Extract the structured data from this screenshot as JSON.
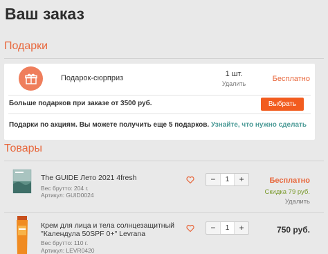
{
  "page": {
    "title": "Ваш заказ"
  },
  "gifts": {
    "heading": "Подарки",
    "item": {
      "name": "Подарок-сюрприз",
      "qty": "1 шт.",
      "remove": "Удалить",
      "price": "Бесплатно",
      "icon": "gift-icon"
    },
    "more_text": "Больше подарков при заказе от 3500 руб.",
    "choose_label": "Выбрать",
    "promo_text": "Подарки по акциям. Вы можете получить еще 5 подарков.",
    "promo_link": "Узнайте, что нужно сделать"
  },
  "goods": {
    "heading": "Товары",
    "items": [
      {
        "name": "The GUIDE Лето 2021 4fresh",
        "weight": "Вес брутто: 204 г.",
        "article": "Артикул: GUID0024",
        "qty": "1",
        "price": "Бесплатно",
        "discount": "Скидка 79 руб.",
        "remove": "Удалить"
      },
      {
        "name_line1": "Крем для лица и тела солнцезащитный",
        "name_line2": "\"Календула 50SPF 0+\" Levrana",
        "weight": "Вес брутто: 110 г.",
        "article": "Артикул: LEVR0420",
        "qty": "1",
        "price": "750 руб."
      }
    ]
  },
  "colors": {
    "accent": "#e8683d",
    "button": "#f25c1f",
    "link": "#4a9a96",
    "discount": "#7a9a2c"
  }
}
